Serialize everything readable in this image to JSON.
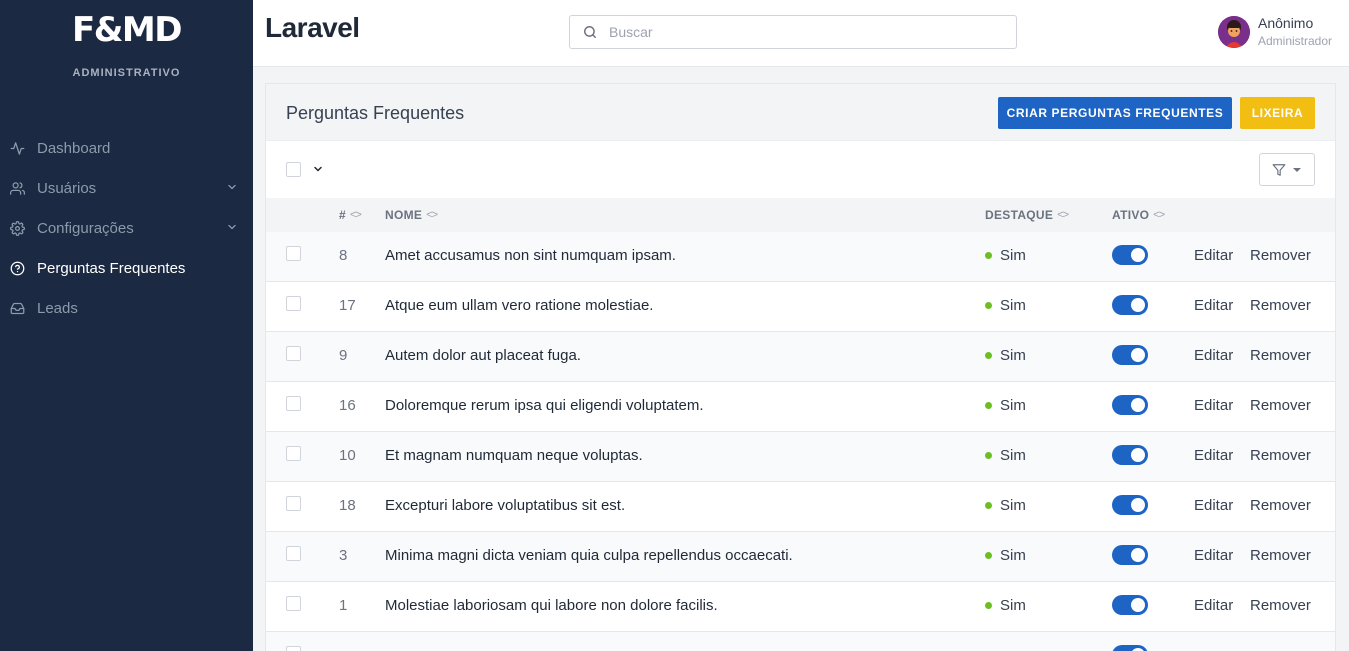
{
  "sidebar": {
    "logo": "F&MD",
    "subtitle": "ADMINISTRATIVO",
    "items": [
      {
        "label": "Dashboard",
        "icon": "activity-icon"
      },
      {
        "label": "Usuários",
        "icon": "users-icon"
      },
      {
        "label": "Configurações",
        "icon": "gear-icon"
      },
      {
        "label": "Perguntas Frequentes",
        "icon": "help-circle-icon"
      },
      {
        "label": "Leads",
        "icon": "inbox-icon"
      }
    ]
  },
  "topbar": {
    "title": "Laravel",
    "search_placeholder": "Buscar",
    "user": {
      "name": "Anônimo",
      "role": "Administrador"
    }
  },
  "card": {
    "title": "Perguntas Frequentes",
    "create_label": "CRIAR PERGUNTAS FREQUENTES",
    "trash_label": "LIXEIRA"
  },
  "table": {
    "columns": {
      "id": "#",
      "name": "NOME",
      "highlight": "DESTAQUE",
      "active": "ATIVO"
    },
    "edit_label": "Editar",
    "remove_label": "Remover",
    "rows": [
      {
        "id": "8",
        "name": "Amet accusamus non sint numquam ipsam.",
        "highlight": "Sim",
        "active": true
      },
      {
        "id": "17",
        "name": "Atque eum ullam vero ratione molestiae.",
        "highlight": "Sim",
        "active": true
      },
      {
        "id": "9",
        "name": "Autem dolor aut placeat fuga.",
        "highlight": "Sim",
        "active": true
      },
      {
        "id": "16",
        "name": "Doloremque rerum ipsa qui eligendi voluptatem.",
        "highlight": "Sim",
        "active": true
      },
      {
        "id": "10",
        "name": "Et magnam numquam neque voluptas.",
        "highlight": "Sim",
        "active": true
      },
      {
        "id": "18",
        "name": "Excepturi labore voluptatibus sit est.",
        "highlight": "Sim",
        "active": true
      },
      {
        "id": "3",
        "name": "Minima magni dicta veniam quia culpa repellendus occaecati.",
        "highlight": "Sim",
        "active": true
      },
      {
        "id": "1",
        "name": "Molestiae laboriosam qui labore non dolore facilis.",
        "highlight": "Sim",
        "active": true
      }
    ]
  },
  "colors": {
    "sidebar_bg": "#1b2942",
    "primary": "#1d64c4",
    "warning": "#f2be12",
    "status_green": "#6bbf1e"
  }
}
